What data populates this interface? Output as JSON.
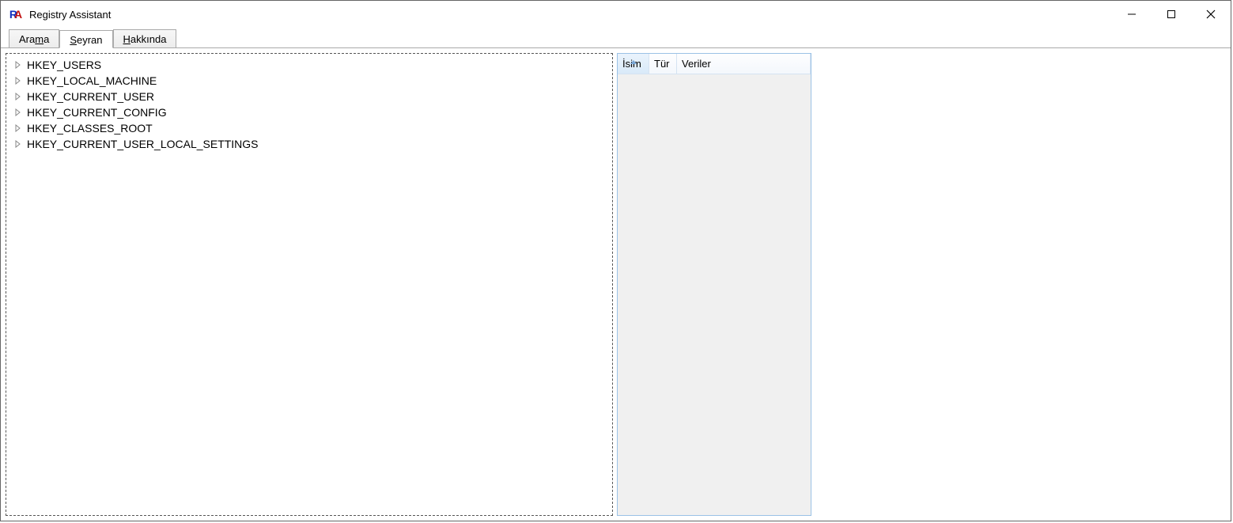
{
  "window": {
    "title": "Registry Assistant"
  },
  "tabs": [
    {
      "pre": "Ara",
      "accel": "m",
      "post": "a",
      "active": false
    },
    {
      "pre": "",
      "accel": "S",
      "post": "eyran",
      "active": true
    },
    {
      "pre": "",
      "accel": "H",
      "post": "akkında",
      "active": false
    }
  ],
  "tree": {
    "items": [
      "HKEY_USERS",
      "HKEY_LOCAL_MACHINE",
      "HKEY_CURRENT_USER",
      "HKEY_CURRENT_CONFIG",
      "HKEY_CLASSES_ROOT",
      "HKEY_CURRENT_USER_LOCAL_SETTINGS"
    ]
  },
  "list": {
    "columns": {
      "name": "İsim",
      "type": "Tür",
      "data": "Veriler"
    },
    "sorted_column": "name",
    "rows": []
  }
}
